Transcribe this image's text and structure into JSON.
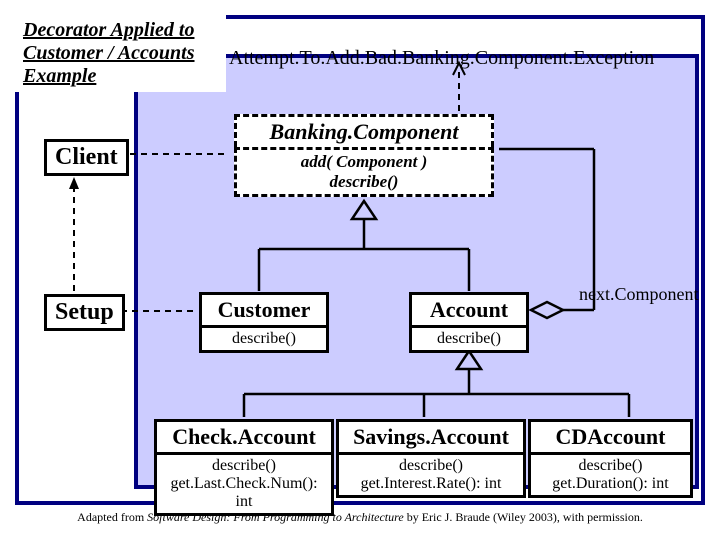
{
  "title": "Decorator Applied to Customer / Accounts Example",
  "exception": "Attempt.To.Add.Bad.Banking.Component.Exception",
  "client": "Client",
  "setup": "Setup",
  "nextLabel": "next.Component",
  "component": {
    "name": "Banking.Component",
    "ops": "add( Component )\ndescribe()"
  },
  "customer": {
    "name": "Customer",
    "ops": "describe()"
  },
  "account": {
    "name": "Account",
    "ops": "describe()"
  },
  "check": {
    "name": "Check.Account",
    "ops": "describe()\nget.Last.Check.Num(): int"
  },
  "savings": {
    "name": "Savings.Account",
    "ops": "describe()\nget.Interest.Rate(): int"
  },
  "cd": {
    "name": "CDAccount",
    "ops": "describe()\nget.Duration(): int"
  },
  "credit": {
    "prefix": "Adapted from ",
    "book": "Software Design: From Programming to Architecture",
    "suffix": " by Eric J. Braude (Wiley 2003), with permission."
  }
}
